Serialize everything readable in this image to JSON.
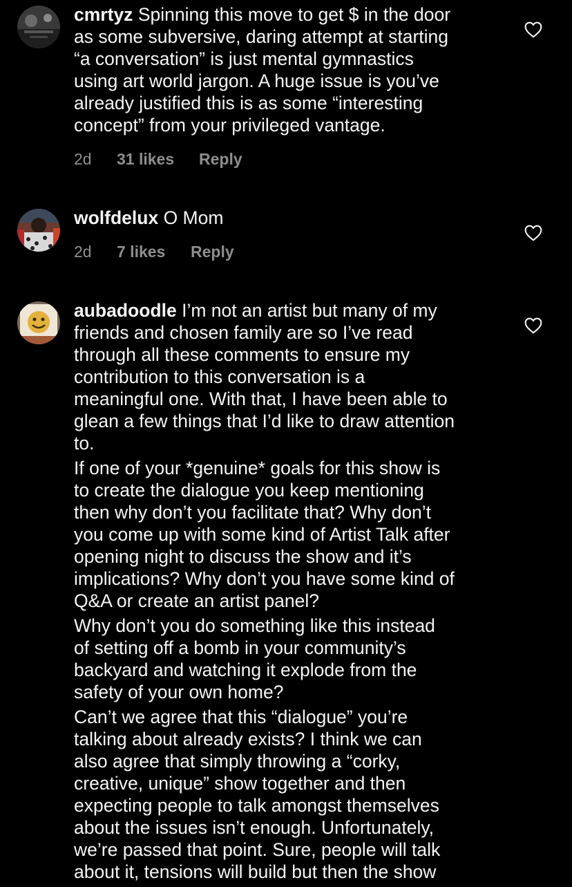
{
  "comments": [
    {
      "username": "cmrtyz",
      "paragraphs": [
        "Spinning this move to get $ in the door\nas some subversive, daring attempt at starting\n“a conversation” is just mental gymnastics\nusing art world jargon. A huge issue is you’ve\nalready justified this is as some “interesting\nconcept” from your privileged vantage."
      ],
      "time": "2d",
      "likes": "31 likes",
      "reply": "Reply"
    },
    {
      "username": "wolfdelux",
      "paragraphs": [
        "O Mom"
      ],
      "time": "2d",
      "likes": "7 likes",
      "reply": "Reply"
    },
    {
      "username": "aubadoodle",
      "paragraphs": [
        "I’m not an artist but many of my\nfriends and chosen family are so I’ve read\nthrough all these comments to ensure my\ncontribution to this conversation is a\nmeaningful one. With that, I have been able to\nglean a few things that I’d like to draw attention\nto.",
        "If one of your *genuine* goals for this show is\nto create the dialogue you keep mentioning\nthen why don’t you facilitate that? Why don’t\nyou come up with some kind of Artist Talk after\nopening night to discuss the show and it’s\nimplications? Why don’t you have some kind of\nQ&A or create an artist panel?",
        "Why don’t you do something like this instead\nof setting off a bomb in your community’s\nbackyard and watching it explode from the\nsafety of your own home?",
        "Can’t we agree that this “dialogue” you’re\ntalking about already exists? I think we can\nalso agree that simply throwing a “corky,\ncreative, unique” show together and then\nexpecting people to talk amongst themselves\nabout the issues isn’t enough. Unfortunately,\nwe’re passed that point. Sure, people will talk\nabout it, tensions will build but then the show"
      ]
    }
  ],
  "icons": {
    "like": "heart-outline-icon"
  },
  "colors": {
    "background": "#000000",
    "text": "#f5f5f5",
    "meta": "#8e8e8e"
  }
}
